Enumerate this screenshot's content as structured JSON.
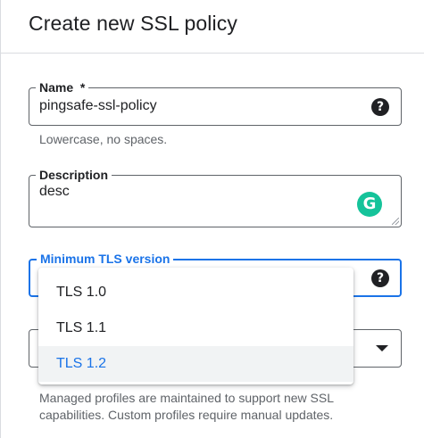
{
  "header": {
    "title": "Create new SSL policy"
  },
  "name_field": {
    "label": "Name",
    "required_mark": "*",
    "value": "pingsafe-ssl-policy",
    "hint": "Lowercase, no spaces."
  },
  "description_field": {
    "label": "Description",
    "value": "desc",
    "grammarly_glyph": "G"
  },
  "tls_field": {
    "label": "Minimum TLS version",
    "options": [
      "TLS 1.0",
      "TLS 1.1",
      "TLS 1.2"
    ],
    "selected": "TLS 1.2"
  },
  "profile_field": {
    "hint_line1": "Managed profiles are maintained to support new SSL",
    "hint_line2": "capabilities. Custom profiles require manual updates."
  },
  "icons": {
    "help": "help-circle-icon",
    "dropdown": "chevron-down-icon",
    "grammarly": "grammarly-icon"
  },
  "colors": {
    "accent": "#1a73e8",
    "grammarly": "#15c39a",
    "border": "#5f6368"
  }
}
